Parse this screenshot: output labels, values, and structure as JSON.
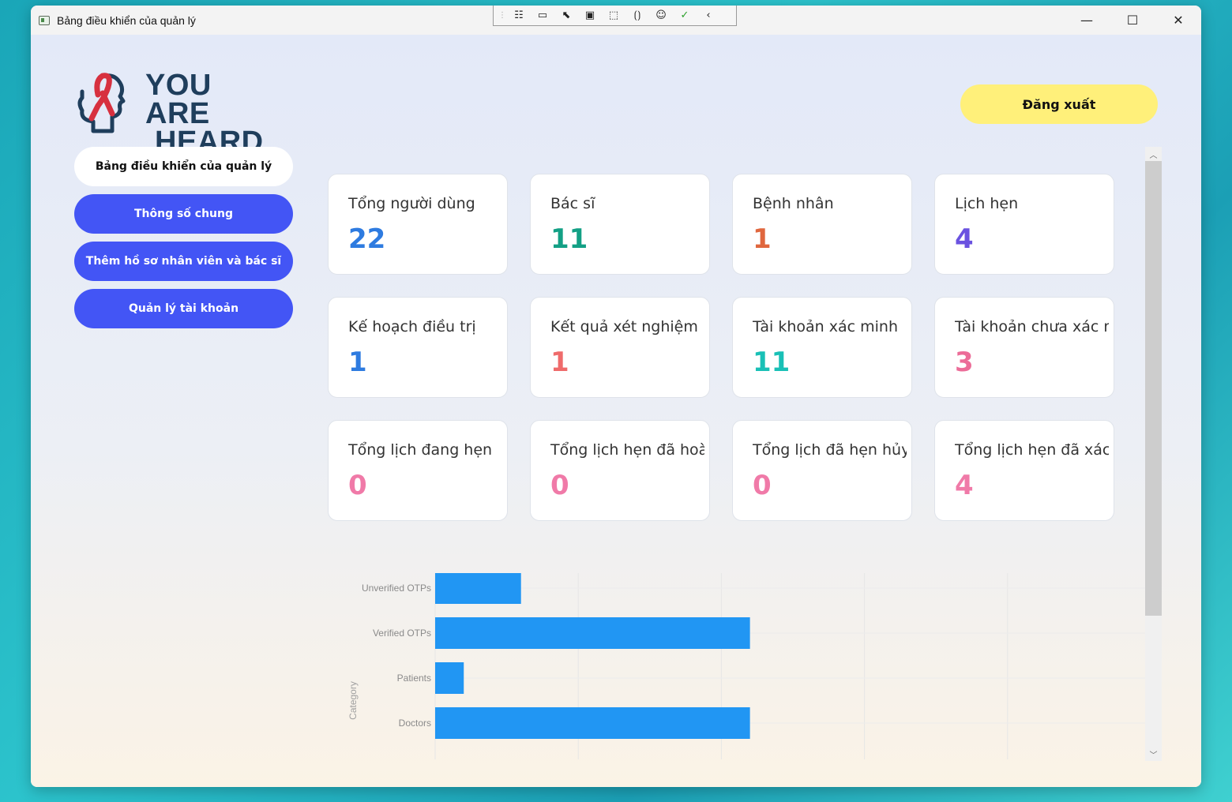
{
  "window": {
    "title": "Bảng điều khiển của quản lý",
    "controls": {
      "minimize": "—",
      "maximize": "☐",
      "close": "✕"
    }
  },
  "debug_toolbar": {
    "icons": [
      "live-visual-tree-icon",
      "record-icon",
      "select-element-icon",
      "display-layout-adorners-icon",
      "track-focus-icon",
      "binding-failures-icon",
      "accessibility-icon",
      "check-icon",
      "collapse-icon"
    ]
  },
  "logo": {
    "line1": "YOU ARE",
    "line2": "HEARD"
  },
  "sidebar": {
    "items": [
      {
        "label": "Bảng điều khiển của quản lý",
        "active": true
      },
      {
        "label": "Thông số chung",
        "active": false
      },
      {
        "label": "Thêm hồ sơ nhân viên và bác sĩ",
        "active": false
      },
      {
        "label": "Quản lý tài khoản",
        "active": false
      }
    ]
  },
  "header": {
    "logout_label": "Đăng xuất"
  },
  "stats": [
    {
      "label": "Tổng người dùng",
      "value": "22",
      "color": "#2e7be0"
    },
    {
      "label": "Bác sĩ",
      "value": "11",
      "color": "#13a085"
    },
    {
      "label": "Bệnh nhân",
      "value": "1",
      "color": "#e0673e"
    },
    {
      "label": "Lịch hẹn",
      "value": "4",
      "color": "#6a52e0"
    },
    {
      "label": "Kế hoạch điều trị",
      "value": "1",
      "color": "#2e7be0"
    },
    {
      "label": "Kết quả xét nghiệm",
      "value": "1",
      "color": "#ef6b6b"
    },
    {
      "label": "Tài khoản xác minh",
      "value": "11",
      "color": "#19c0b6"
    },
    {
      "label": "Tài khoản chưa xác minh",
      "value": "3",
      "color": "#ec6c98"
    },
    {
      "label": "Tổng lịch đang hẹn",
      "value": "0",
      "color": "#f07aa8"
    },
    {
      "label": "Tổng lịch hẹn đã hoàn thành",
      "value": "0",
      "color": "#f07aa8"
    },
    {
      "label": "Tổng lịch đã hẹn hủy",
      "value": "0",
      "color": "#f07aa8"
    },
    {
      "label": "Tổng lịch hẹn đã xác nhận",
      "value": "4",
      "color": "#f07aa8"
    }
  ],
  "chart_data": {
    "type": "bar",
    "orientation": "horizontal",
    "categories": [
      "Unverified OTPs",
      "Verified OTPs",
      "Patients",
      "Doctors"
    ],
    "values": [
      3,
      11,
      1,
      11
    ],
    "xlim": [
      0,
      25
    ],
    "ylabel": "Category",
    "bar_color": "#2196f3",
    "grid": true
  }
}
